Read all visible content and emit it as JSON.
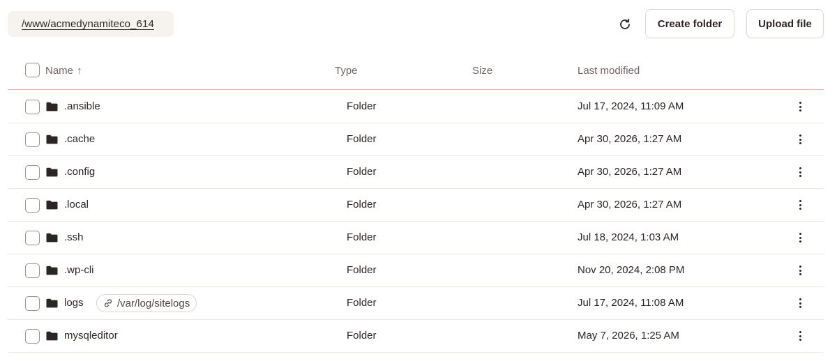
{
  "breadcrumb": {
    "path": "/www/acmedynamiteco_614"
  },
  "toolbar": {
    "refresh_icon": "refresh-icon",
    "create_folder_label": "Create folder",
    "upload_file_label": "Upload file"
  },
  "table": {
    "columns": {
      "name": "Name",
      "type": "Type",
      "size": "Size",
      "last_modified": "Last modified"
    },
    "sort_indicator": "↑",
    "rows": [
      {
        "name": ".ansible",
        "type": "Folder",
        "size": "",
        "modified": "Jul 17, 2024, 11:09 AM"
      },
      {
        "name": ".cache",
        "type": "Folder",
        "size": "",
        "modified": "Apr 30, 2026, 1:27 AM"
      },
      {
        "name": ".config",
        "type": "Folder",
        "size": "",
        "modified": "Apr 30, 2026, 1:27 AM"
      },
      {
        "name": ".local",
        "type": "Folder",
        "size": "",
        "modified": "Apr 30, 2026, 1:27 AM"
      },
      {
        "name": ".ssh",
        "type": "Folder",
        "size": "",
        "modified": "Jul 18, 2024, 1:03 AM"
      },
      {
        "name": ".wp-cli",
        "type": "Folder",
        "size": "",
        "modified": "Nov 20, 2024, 2:08 PM"
      },
      {
        "name": "logs",
        "type": "Folder",
        "size": "",
        "modified": "Jul 17, 2024, 11:08 AM",
        "symlink": "/var/log/sitelogs"
      },
      {
        "name": "mysqleditor",
        "type": "Folder",
        "size": "",
        "modified": "May 7, 2026, 1:25 AM"
      }
    ]
  },
  "colors": {
    "accent_border": "#e4b9a4",
    "breadcrumb_bg": "#f6f3ef",
    "text": "#2b2523",
    "muted": "#6f6662"
  }
}
